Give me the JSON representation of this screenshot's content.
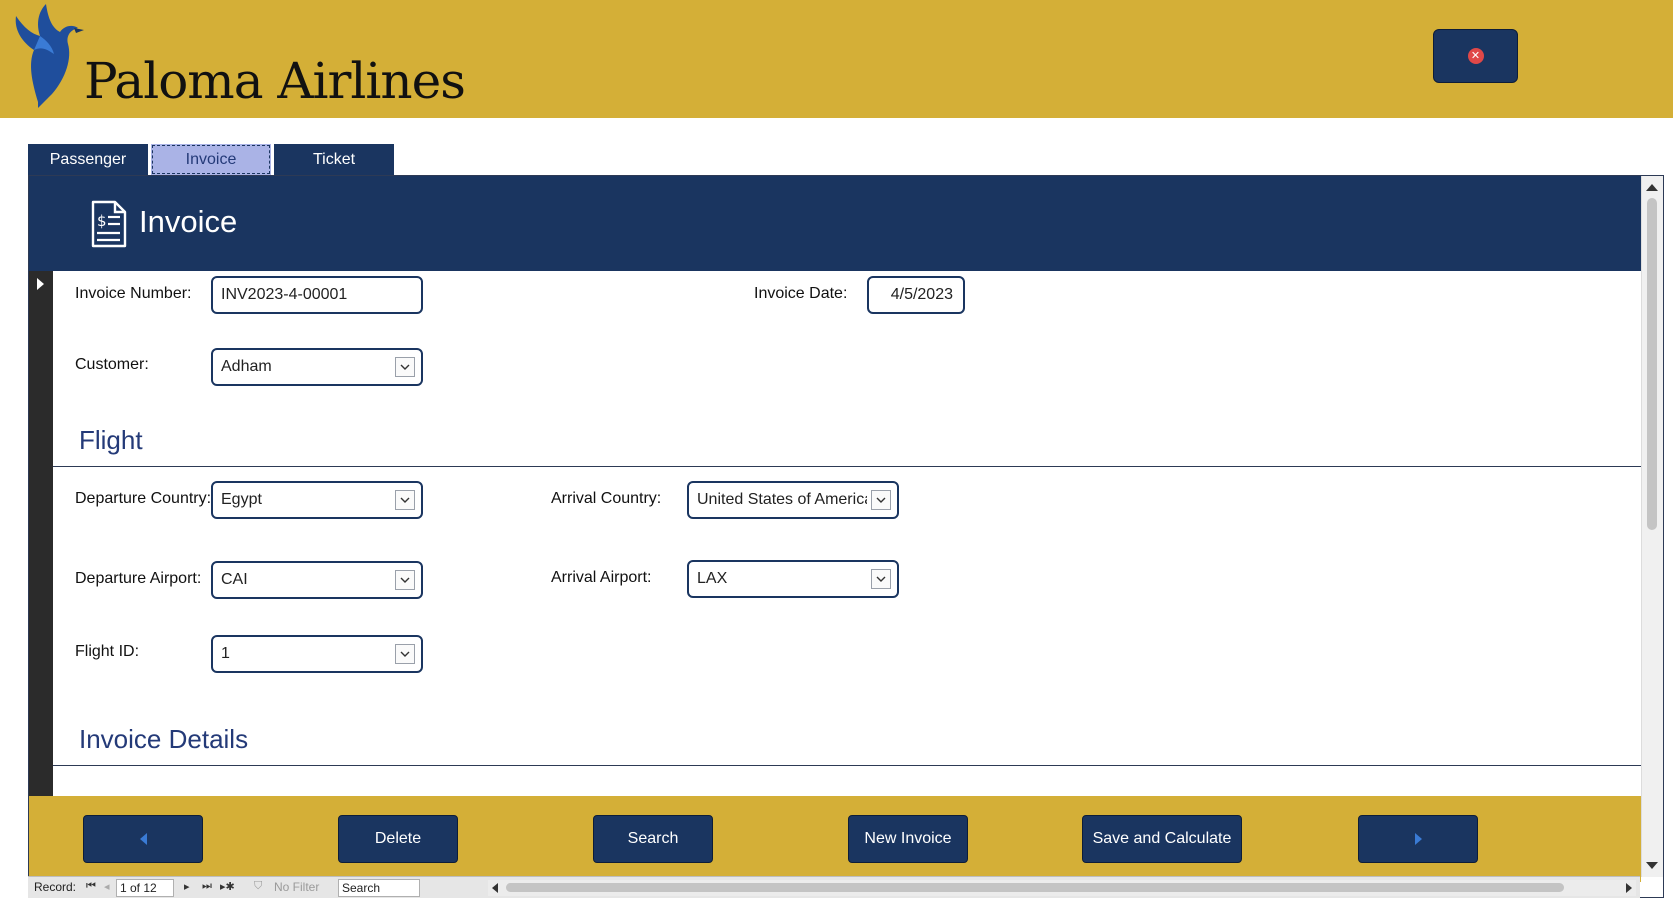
{
  "app": {
    "brand": "Paloma Airlines",
    "close_icon": "close-icon",
    "colors": {
      "gold": "#D4AF37",
      "navy": "#1a3560",
      "active_tab": "#aab3e6",
      "section_title": "#243a78"
    }
  },
  "tabs": [
    {
      "label": "Passenger",
      "active": false
    },
    {
      "label": "Invoice",
      "active": true
    },
    {
      "label": "Ticket",
      "active": false
    }
  ],
  "header": {
    "title": "Invoice",
    "icon": "invoice-document-icon"
  },
  "form": {
    "invoice_number": {
      "label": "Invoice Number:",
      "value": "INV2023-4-00001"
    },
    "invoice_date": {
      "label": "Invoice Date:",
      "value": "4/5/2023"
    },
    "customer": {
      "label": "Customer:",
      "value": "Adham"
    },
    "flight_section": "Flight",
    "departure_country": {
      "label": "Departure Country:",
      "value": "Egypt"
    },
    "arrival_country": {
      "label": "Arrival Country:",
      "value": "United States of America"
    },
    "departure_airport": {
      "label": "Departure Airport:",
      "value": "CAI"
    },
    "arrival_airport": {
      "label": "Arrival Airport:",
      "value": "LAX"
    },
    "flight_id": {
      "label": "Flight ID:",
      "value": "1"
    },
    "details_section": "Invoice Details"
  },
  "footer": {
    "delete_label": "Delete",
    "search_label": "Search",
    "new_label": "New Invoice",
    "save_label": "Save and Calculate",
    "prev_icon": "arrow-left-icon",
    "next_icon": "arrow-right-icon"
  },
  "navbar": {
    "record_label": "Record:",
    "position": "1 of 12",
    "filter_label": "No Filter",
    "search_label": "Search"
  }
}
